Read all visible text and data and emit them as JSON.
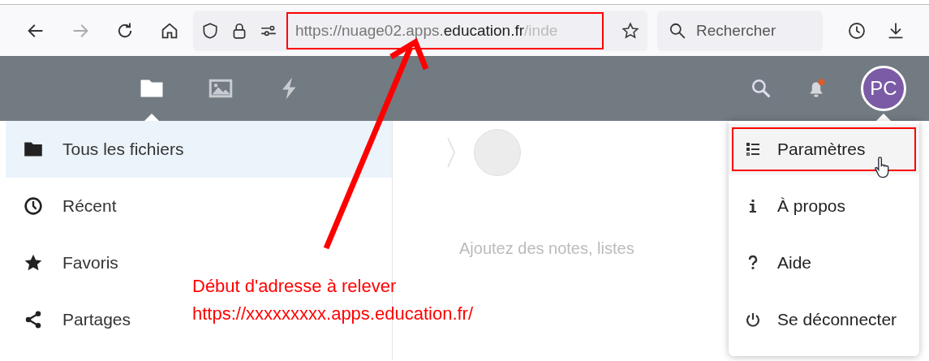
{
  "browser": {
    "url": {
      "prefix": "https://nuage02.apps.",
      "domain": "education.fr",
      "suffix": "/inde"
    },
    "search": {
      "placeholder": "Rechercher"
    }
  },
  "header": {
    "apps": [
      {
        "kind": "files",
        "selected": true
      },
      {
        "kind": "photos",
        "selected": false
      },
      {
        "kind": "activity",
        "selected": false
      }
    ],
    "notifications": {
      "unread": true
    },
    "avatar": {
      "initials": "PC",
      "color": "#7b5aa6"
    }
  },
  "sidebar": {
    "items": [
      {
        "label": "Tous les fichiers",
        "selected": true
      },
      {
        "label": "Récent",
        "selected": false
      },
      {
        "label": "Favoris",
        "selected": false
      },
      {
        "label": "Partages",
        "selected": false
      }
    ]
  },
  "content": {
    "hint": "Ajoutez des notes, listes"
  },
  "user_menu": {
    "items": [
      {
        "label": "Paramètres",
        "selected": true,
        "highlighted": true
      },
      {
        "label": "À propos",
        "selected": false,
        "highlighted": false
      },
      {
        "label": "Aide",
        "selected": false,
        "highlighted": false
      },
      {
        "label": "Se déconnecter",
        "selected": false,
        "highlighted": false
      }
    ]
  },
  "annotation": {
    "lines": [
      "Début d'adresse à relever",
      "https://xxxxxxxxx.apps.education.fr/"
    ],
    "url_highlighted": true
  }
}
